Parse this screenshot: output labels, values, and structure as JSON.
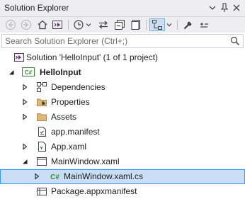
{
  "window": {
    "title": "Solution Explorer"
  },
  "search": {
    "placeholder": "Search Solution Explorer (Ctrl+;)",
    "value": ""
  },
  "tree": {
    "solution": "Solution 'HelloInput' (1 of 1 project)",
    "project": "HelloInput",
    "project_badge": "C#",
    "items": [
      {
        "label": "Dependencies"
      },
      {
        "label": "Properties"
      },
      {
        "label": "Assets"
      },
      {
        "label": "app.manifest"
      },
      {
        "label": "App.xaml"
      },
      {
        "label": "MainWindow.xaml"
      },
      {
        "label": "MainWindow.xaml.cs",
        "badge": "C#"
      },
      {
        "label": "Package.appxmanifest"
      }
    ]
  },
  "colors": {
    "accent": "#3399ff",
    "selection": "#c9def5",
    "folder": "#dcb67a",
    "csharp": "#388a34"
  }
}
